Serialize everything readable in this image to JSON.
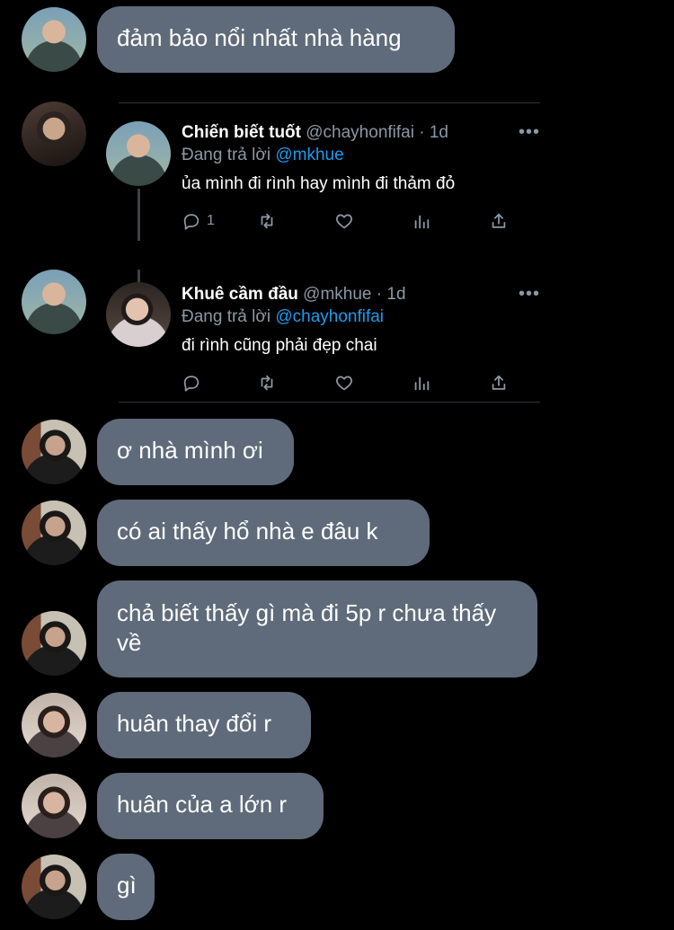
{
  "messages": [
    {
      "text": "đảm bảo nổi nhất nhà hàng"
    },
    {
      "text": "ơ nhà mình ơi"
    },
    {
      "text": "có ai thấy hổ nhà e đâu k"
    },
    {
      "text": "chả biết thấy gì mà đi 5p r  chưa thấy về"
    },
    {
      "text": "huân thay đổi r"
    },
    {
      "text": "huân của a lớn r"
    },
    {
      "text": "gì"
    }
  ],
  "tweets": [
    {
      "name": "Chiến biết tuốt",
      "handle": "@chayhonfifai",
      "time": "1d",
      "reply_prefix": "Đang trả lời",
      "reply_to": "@mkhue",
      "text": "ủa mình đi rình hay mình đi thảm đỏ",
      "reply_count": "1",
      "more": "•••"
    },
    {
      "name": "Khuê cầm đầu",
      "handle": "@mkhue",
      "time": "1d",
      "reply_prefix": "Đang trả lời",
      "reply_to": "@chayhonfifai",
      "text": "đi rình cũng phải đẹp chai",
      "reply_count": "",
      "more": "•••"
    }
  ],
  "meta_separator": "·",
  "colors": {
    "background": "#000000",
    "bubble": "#5f6b7a",
    "mention": "#1d9bf0",
    "muted": "#8b98a5"
  },
  "icons": [
    "reply-icon",
    "retweet-icon",
    "like-icon",
    "analytics-icon",
    "share-icon",
    "more-icon"
  ]
}
